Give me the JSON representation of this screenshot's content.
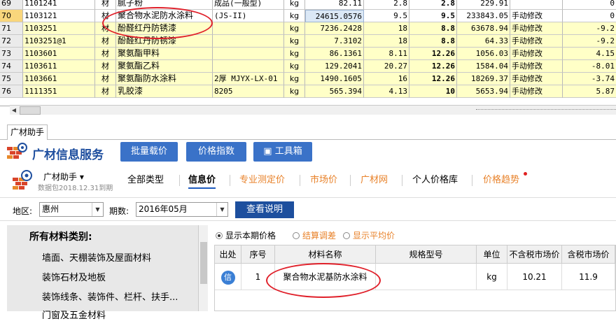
{
  "grid_rows": [
    {
      "rn": "69",
      "code": "1101241",
      "cat": "材",
      "name": "腻子粉",
      "spec": "成品(一般型)",
      "unit": "kg",
      "qty": "82.11",
      "n1": "2.8",
      "n2": "2.8",
      "n3": "229.91",
      "mod": "",
      "diff": "0",
      "yellow": false
    },
    {
      "rn": "70",
      "code": "1103121",
      "cat": "材",
      "name": "聚合物水泥防水涂料",
      "spec": "(JS-II)",
      "unit": "kg",
      "qty": "24615.0576",
      "n1": "9.5",
      "n2": "9.5",
      "n3": "233843.05",
      "mod": "手动修改",
      "diff": "0",
      "yellow": false
    },
    {
      "rn": "71",
      "code": "1103251",
      "cat": "材",
      "name": "酚醛红丹防锈漆",
      "spec": "",
      "unit": "kg",
      "qty": "7236.2428",
      "n1": "18",
      "n2": "8.8",
      "n3": "63678.94",
      "mod": "手动修改",
      "diff": "-9.2",
      "yellow": true
    },
    {
      "rn": "72",
      "code": "1103251@1",
      "cat": "材",
      "name": "酚醛红丹防锈漆",
      "spec": "",
      "unit": "kg",
      "qty": "7.3102",
      "n1": "18",
      "n2": "8.8",
      "n3": "64.33",
      "mod": "手动修改",
      "diff": "-9.2",
      "yellow": true
    },
    {
      "rn": "73",
      "code": "1103601",
      "cat": "材",
      "name": "聚氨酯甲料",
      "spec": "",
      "unit": "kg",
      "qty": "86.1361",
      "n1": "8.11",
      "n2": "12.26",
      "n3": "1056.03",
      "mod": "手动修改",
      "diff": "4.15",
      "yellow": true
    },
    {
      "rn": "74",
      "code": "1103611",
      "cat": "材",
      "name": "聚氨酯乙料",
      "spec": "",
      "unit": "kg",
      "qty": "129.2041",
      "n1": "20.27",
      "n2": "12.26",
      "n3": "1584.04",
      "mod": "手动修改",
      "diff": "-8.01",
      "yellow": true
    },
    {
      "rn": "75",
      "code": "1103661",
      "cat": "材",
      "name": "聚氨酯防水涂料",
      "spec": "2厚 MJYX-LX-01",
      "unit": "kg",
      "qty": "1490.1605",
      "n1": "16",
      "n2": "12.26",
      "n3": "18269.37",
      "mod": "手动修改",
      "diff": "-3.74",
      "yellow": true
    },
    {
      "rn": "76",
      "code": "1111351",
      "cat": "材",
      "name": "乳胶漆",
      "spec": "8205",
      "unit": "kg",
      "qty": "565.394",
      "n1": "4.13",
      "n2": "10",
      "n3": "5653.94",
      "mod": "手动修改",
      "diff": "5.87",
      "yellow": true
    }
  ],
  "panel": {
    "tab": "广材助手",
    "title": "广材信息服务",
    "buttons": [
      "批量载价",
      "价格指数",
      "工具箱"
    ],
    "assistant_name": "广材助手 ▾",
    "data_package": "数据包2018.12.31到期",
    "nav": [
      "全部类型",
      "信息价",
      "专业测定价",
      "市场价",
      "广材网",
      "个人价格库",
      "价格趋势"
    ]
  },
  "filter": {
    "region_label": "地区:",
    "region_value": "惠州",
    "period_label": "期数:",
    "period_value": "2016年05月",
    "explain_button": "查看说明"
  },
  "categories": {
    "heading": "所有材料类别:",
    "items": [
      "墙面、天棚装饰及屋面材料",
      "装饰石材及地板",
      "装饰线条、装饰件、栏杆、扶手...",
      "门窗及五金材料"
    ]
  },
  "price_options": [
    "显示本期价格",
    "结算调差",
    "显示平均价"
  ],
  "result": {
    "headers": [
      "出处",
      "序号",
      "材料名称",
      "规格型号",
      "单位",
      "不含税市场价",
      "含税市场价"
    ],
    "row": {
      "source": "信",
      "index": "1",
      "name": "聚合物水泥基防水涂料",
      "spec": "",
      "unit": "kg",
      "price_ex": "10.21",
      "price_in": "11.9"
    }
  }
}
